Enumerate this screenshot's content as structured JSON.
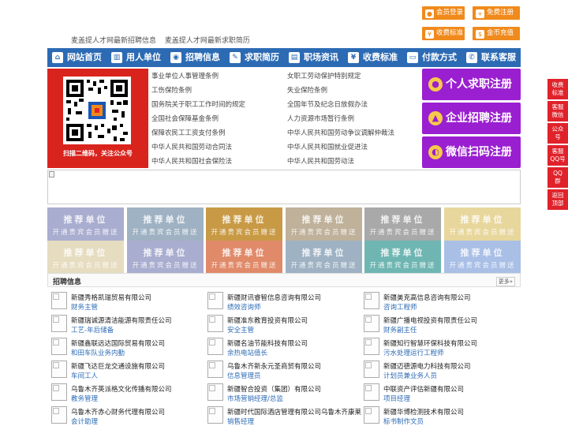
{
  "top_links": [
    "麦盖提人才网最新招聘信息",
    "麦盖提人才网最新求职简历"
  ],
  "top_buttons": [
    {
      "label": "会员登录",
      "icon": "user-icon"
    },
    {
      "label": "免费注册",
      "icon": "user-add-icon"
    },
    {
      "label": "收费标准",
      "icon": "yen-icon"
    },
    {
      "label": "金币充值",
      "icon": "coin-icon"
    }
  ],
  "nav": [
    {
      "label": "网站首页",
      "icon": "home-icon",
      "glyph": "⌂"
    },
    {
      "label": "用人单位",
      "icon": "building-icon",
      "glyph": "▥"
    },
    {
      "label": "招聘信息",
      "icon": "megaphone-icon",
      "glyph": "◉"
    },
    {
      "label": "求职简历",
      "icon": "resume-icon",
      "glyph": "✎"
    },
    {
      "label": "职场资讯",
      "icon": "news-icon",
      "glyph": "▤"
    },
    {
      "label": "收费标准",
      "icon": "price-icon",
      "glyph": "¥"
    },
    {
      "label": "付款方式",
      "icon": "payment-icon",
      "glyph": "▭"
    },
    {
      "label": "联系客服",
      "icon": "phone-icon",
      "glyph": "✆"
    }
  ],
  "qr_caption": "扫描二维码，关注公众号",
  "laws": [
    "事业单位人事管理条例",
    "女职工劳动保护特别规定",
    "工伤保险条例",
    "失业保险条例",
    "国务院关于职工工作时间的规定",
    "全国年节及纪念日放假办法",
    "全国社会保障基金条例",
    "人力资源市场暂行条例",
    "保障农民工工资支付条例",
    "中华人民共和国劳动争议调解仲裁法",
    "中华人民共和国劳动合同法",
    "中华人民共和国就业促进法",
    "中华人民共和国社会保险法",
    "中华人民共和国劳动法"
  ],
  "register": [
    {
      "label": "个人求职注册",
      "icon": "person-icon"
    },
    {
      "label": "企业招聘注册",
      "icon": "company-icon"
    },
    {
      "label": "微信扫码注册",
      "icon": "wechat-icon"
    }
  ],
  "float_bar": [
    "收费\n标准",
    "客服\n微信",
    "公众\n号",
    "客服\nQQ号",
    "QQ\n群",
    "返回\n顶部"
  ],
  "recommend": {
    "title": "推荐单位",
    "subtitle": "开通贵宾会员赠送",
    "colors": [
      "#a9adcf",
      "#9fb2c3",
      "#c99a45",
      "#bfb19a",
      "#a8a9a8",
      "#e8d79c",
      "#e6dcc0",
      "#a9adcf",
      "#e08a6a",
      "#9fb2c3",
      "#6fb6b3",
      "#a9bfe6"
    ]
  },
  "jobs": {
    "title": "招聘信息",
    "more": "更多»",
    "items": [
      {
        "company": "新疆秀格凯瑞贸易有限公司",
        "position": "财务主管"
      },
      {
        "company": "新疆财讯睿智信息咨询有限公司",
        "position": "绩效咨询师"
      },
      {
        "company": "新疆美克高信息咨询有限公司",
        "position": "咨询工程师"
      },
      {
        "company": "新疆瑞诚源清洁能源有限责任公司",
        "position": "工艺-年后储备"
      },
      {
        "company": "新疆准东教育投资有限公司",
        "position": "安全主管"
      },
      {
        "company": "新疆广播电视投资有限责任公司",
        "position": "财务副主任"
      },
      {
        "company": "新疆鑫联远达国际贸易有限公司",
        "position": "和田车队业务内勤"
      },
      {
        "company": "新疆名油节能科技有限公司",
        "position": "余热电站值长"
      },
      {
        "company": "新疆知行智慧环保科技有限公司",
        "position": "污水处理运行工程师"
      },
      {
        "company": "新疆飞达巨龙交通设施有限公司",
        "position": "车间工人"
      },
      {
        "company": "乌鲁木齐新永元圣商贸有限公司",
        "position": "信息管理员"
      },
      {
        "company": "新疆迈德源电力科技有限公司",
        "position": "计划员兼业务人员"
      },
      {
        "company": "乌鲁木齐英派格文化传播有限公司",
        "position": "教务管理"
      },
      {
        "company": "新疆智合投资（集团）有限公司",
        "position": "市场营销经理/总监"
      },
      {
        "company": "中联资产评估新疆有限公司",
        "position": "项目经理"
      },
      {
        "company": "乌鲁木齐赤心财务代理有限公司",
        "position": "会计助理"
      },
      {
        "company": "新疆时代国际酒店管理有限公司乌鲁木齐康莱",
        "position": "销售经理"
      },
      {
        "company": "新疆华博检测技术有限公司",
        "position": "标书制作文员"
      }
    ]
  }
}
